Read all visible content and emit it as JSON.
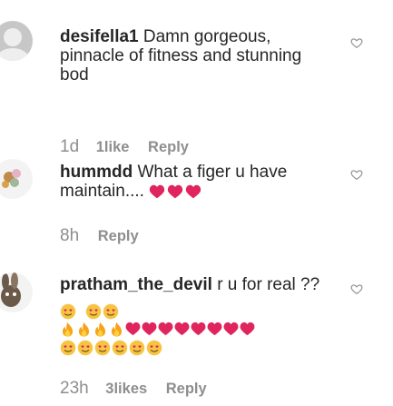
{
  "comments": [
    {
      "username": "desifella1",
      "text": "Damn gorgeous, pinnacle of fitness and stunning bod",
      "time": "1d",
      "likes": "1like",
      "reply": "Reply",
      "avatar_icon": "default-avatar-icon",
      "like_icon": "heart-outline-icon"
    },
    {
      "username": "hummdd",
      "text": "What a figer u have maintain....",
      "time": "8h",
      "reply": "Reply",
      "emojis": [
        "red-heart",
        "red-heart",
        "red-heart"
      ],
      "avatar_icon": "flower-avatar-icon",
      "like_icon": "heart-outline-icon"
    },
    {
      "username": "pratham_the_devil",
      "text": "r u for real ??",
      "time": "23h",
      "likes": "3likes",
      "reply": "Reply",
      "emoji_rows": [
        [
          "heart-eyes-face",
          "heart-eyes-face",
          "heart-eyes-face"
        ],
        [
          "fire",
          "fire",
          "fire",
          "fire",
          "red-heart",
          "red-heart",
          "red-heart",
          "red-heart",
          "red-heart",
          "red-heart",
          "red-heart",
          "red-heart"
        ],
        [
          "heart-eyes-face",
          "heart-eyes-face",
          "heart-eyes-face",
          "heart-eyes-face",
          "heart-eyes-face",
          "heart-eyes-face"
        ]
      ],
      "avatar_icon": "bunny-avatar-icon",
      "like_icon": "heart-outline-icon"
    }
  ],
  "colors": {
    "text": "#262626",
    "meta": "#8e8e8e",
    "heart_outline": "#8e8e8e",
    "red_heart": "#e0245e",
    "fire": "#f7a21b",
    "emoji_face": "#f5c542"
  }
}
